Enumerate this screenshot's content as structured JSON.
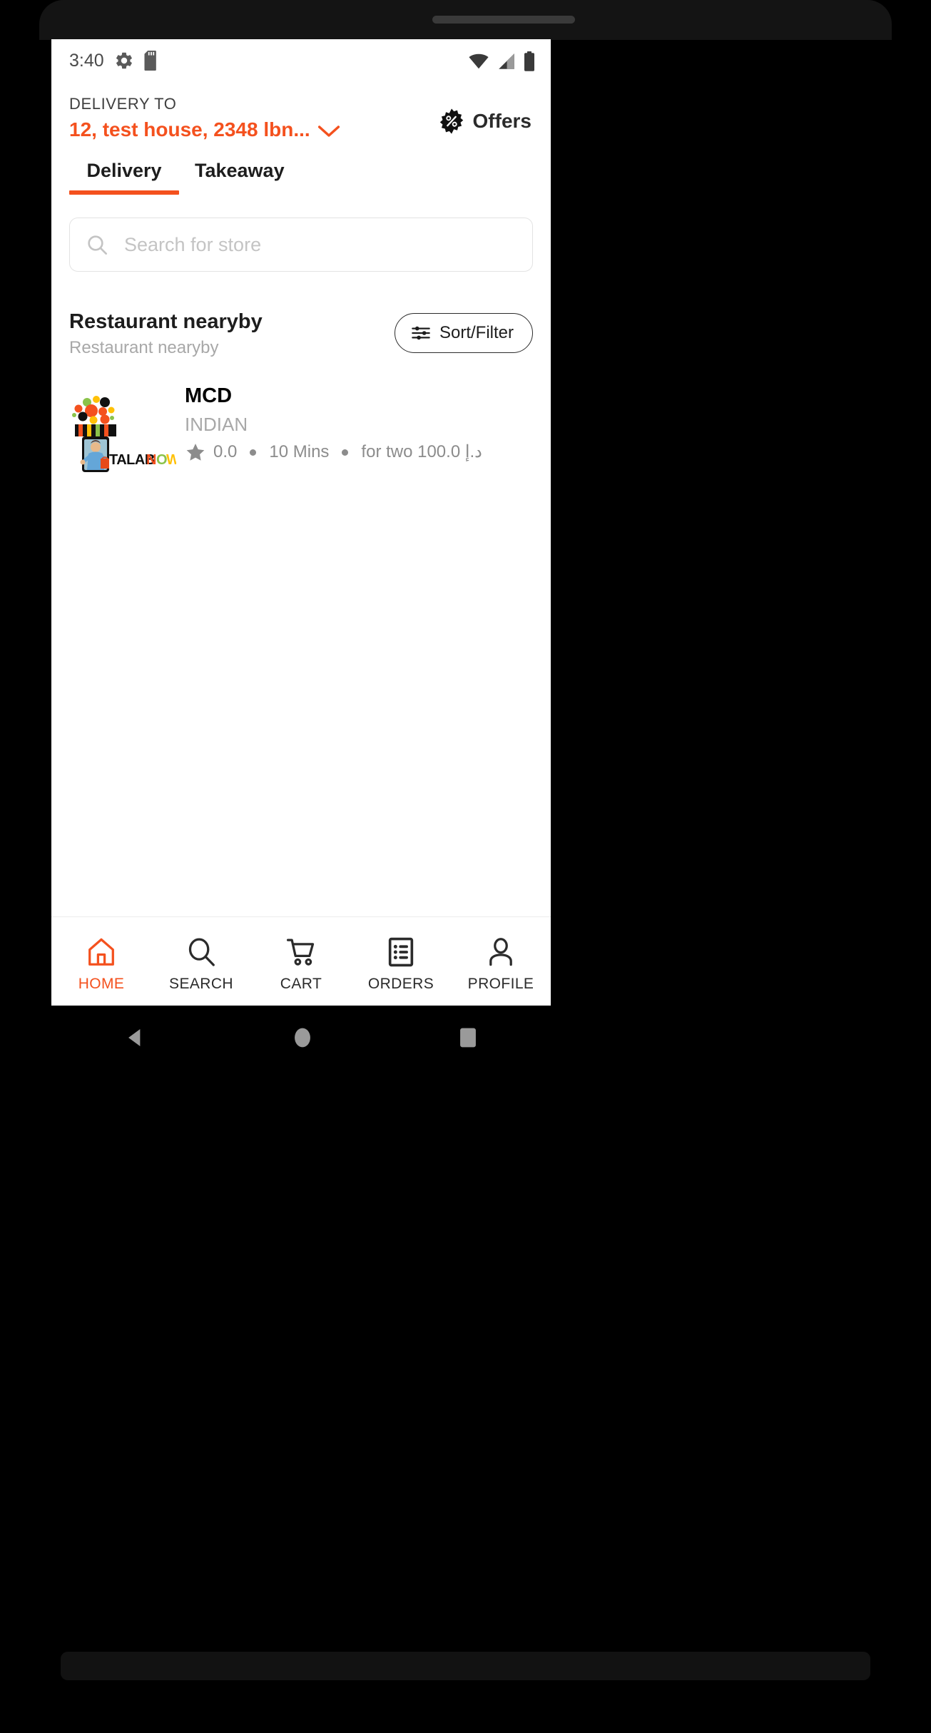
{
  "status_bar": {
    "time": "3:40",
    "left_icons": [
      "gear-icon",
      "sd-card-icon"
    ],
    "right_icons": [
      "wifi-icon",
      "cellular-signal-icon",
      "battery-icon"
    ]
  },
  "header": {
    "delivery_to_label": "DELIVERY TO",
    "address": "12, test house, 2348 lbn...",
    "address_color": "#F4511E",
    "chevron_icon": "chevron-down-icon",
    "offers": {
      "label": "Offers",
      "icon": "percent-badge-icon"
    }
  },
  "tabs": {
    "items": [
      {
        "label": "Delivery",
        "active": true
      },
      {
        "label": "Takeaway",
        "active": false
      }
    ],
    "active_color": "#F4511E"
  },
  "search": {
    "placeholder": "Search for store",
    "value": "",
    "icon": "search-icon"
  },
  "section": {
    "title": "Restaurant nearyby",
    "subtitle": "Restaurant nearyby",
    "sort_filter": {
      "label": "Sort/Filter",
      "icon": "tune-icon"
    }
  },
  "restaurants": [
    {
      "name": "MCD",
      "cuisine": "INDIAN",
      "rating": "0.0",
      "delivery_time": "10 Mins",
      "price_for_two": "for two 100.0 د.إ",
      "logo_text": "TALABNOW",
      "logo_alt": "talabnow-storefront-logo"
    }
  ],
  "bottom_nav": {
    "items": [
      {
        "label": "HOME",
        "icon": "home-icon",
        "active": true
      },
      {
        "label": "SEARCH",
        "icon": "search-icon",
        "active": false
      },
      {
        "label": "CART",
        "icon": "cart-icon",
        "active": false
      },
      {
        "label": "ORDERS",
        "icon": "orders-list-icon",
        "active": false
      },
      {
        "label": "PROFILE",
        "icon": "person-icon",
        "active": false
      }
    ],
    "active_color": "#F4511E"
  },
  "system_nav": {
    "back": "back-triangle-icon",
    "home": "home-circle-icon",
    "recents": "recents-square-icon"
  }
}
